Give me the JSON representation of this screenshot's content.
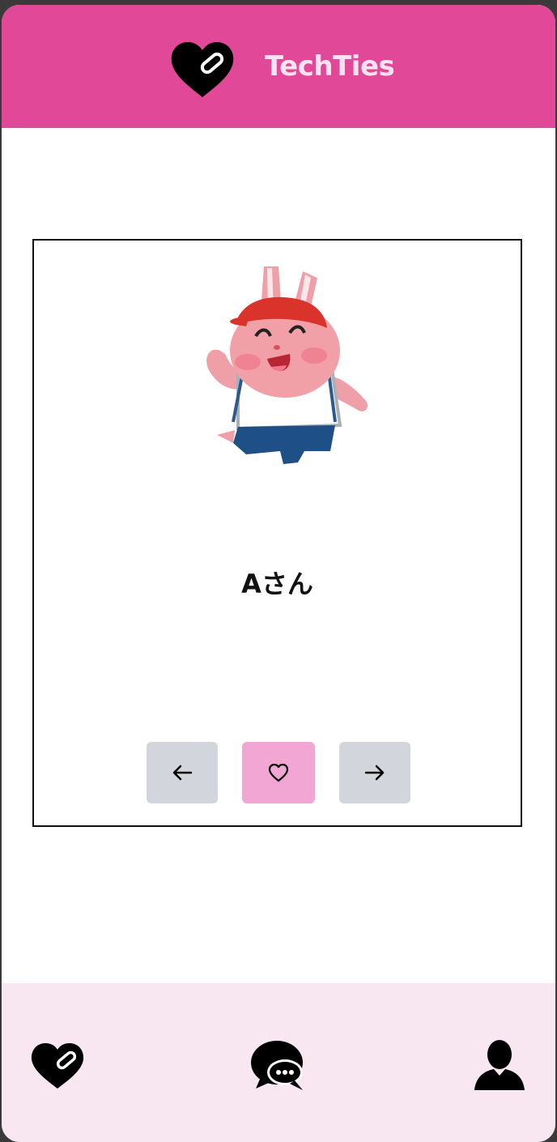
{
  "header": {
    "title": "TechTies",
    "logo_icon": "heart-chip-icon"
  },
  "profile_card": {
    "avatar_icon": "rabbit-character-illustration",
    "name": "Aさん",
    "actions": {
      "prev_icon": "arrow-left-icon",
      "like_icon": "heart-outline-icon",
      "next_icon": "arrow-right-icon"
    }
  },
  "bottom_nav": {
    "items": [
      {
        "icon": "heart-chip-icon"
      },
      {
        "icon": "chat-bubbles-icon"
      },
      {
        "icon": "user-icon"
      }
    ]
  },
  "colors": {
    "header_bg": "#e24898",
    "header_title": "#f9e3ef",
    "nav_bg": "#f8e6f1",
    "like_button": "#f2a6d3",
    "arrow_button": "#d2d5dc"
  }
}
